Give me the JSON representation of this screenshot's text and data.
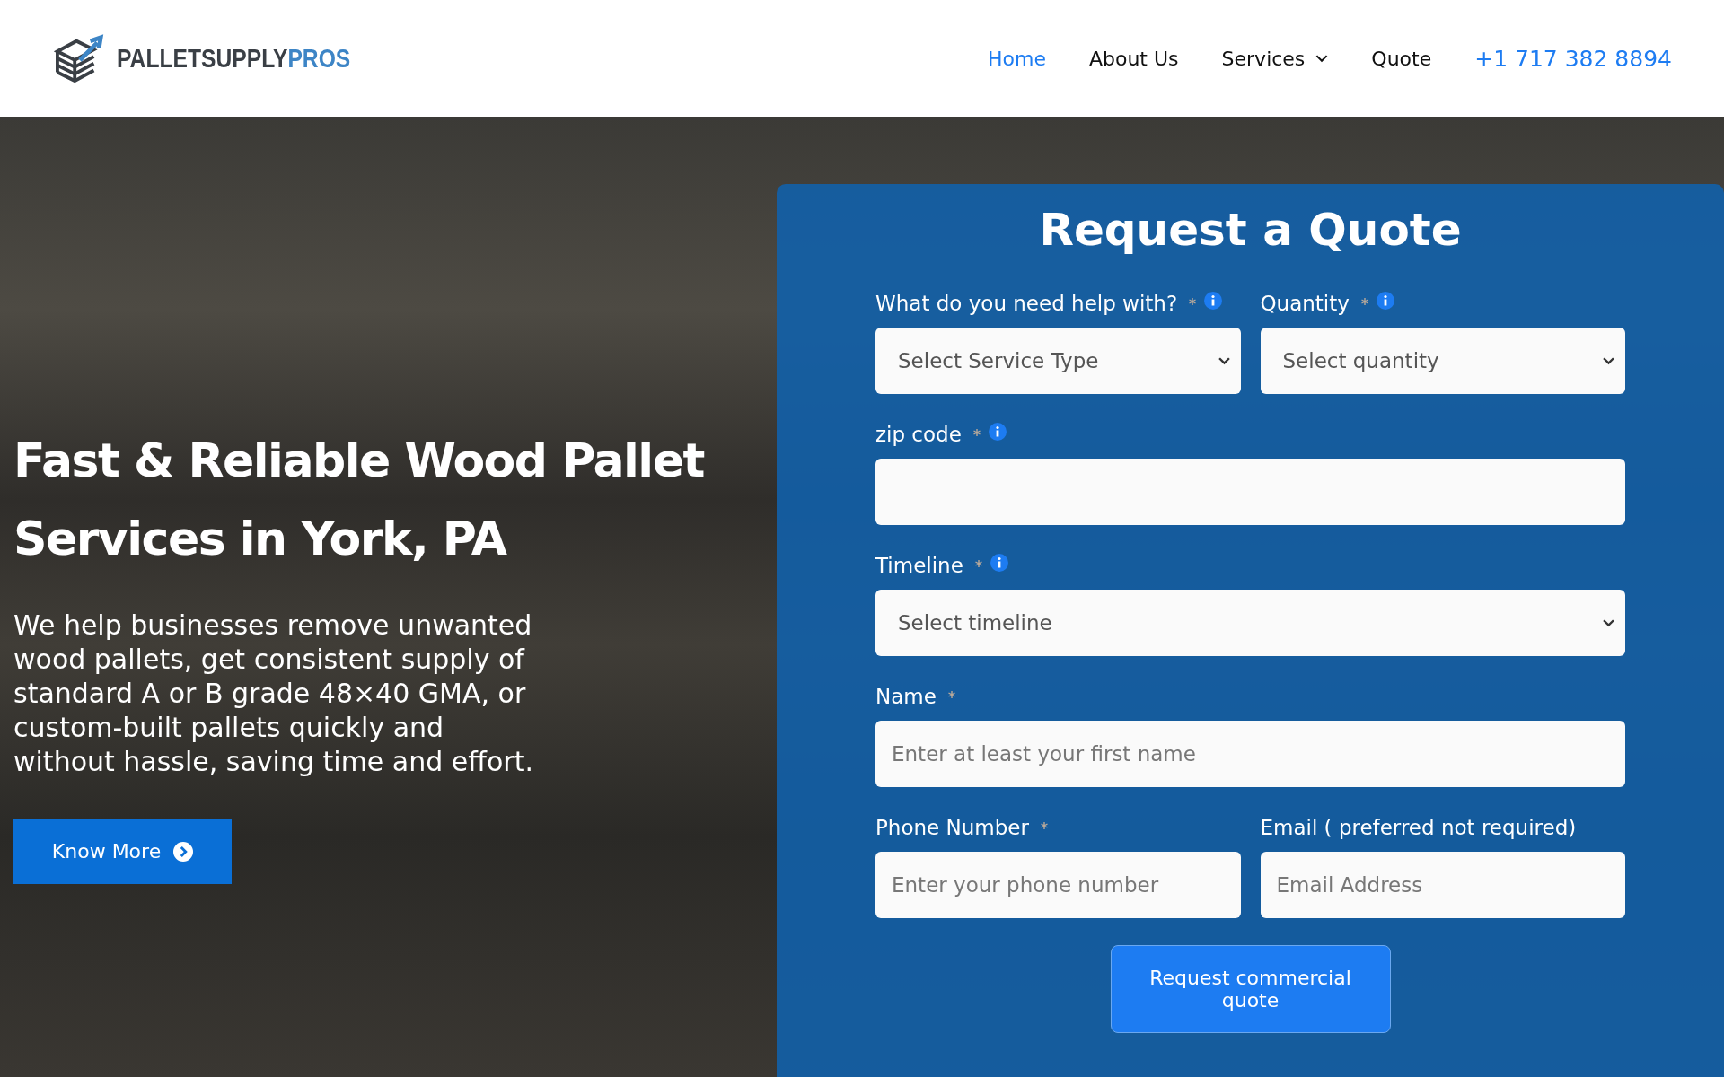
{
  "logo": {
    "name": "PALLETSUPPLY",
    "accent": "PROS"
  },
  "nav": [
    {
      "label": "Home",
      "selected": true,
      "dropdown": false
    },
    {
      "label": "About Us",
      "selected": false,
      "dropdown": false
    },
    {
      "label": "Services",
      "selected": false,
      "dropdown": true
    },
    {
      "label": "Quote",
      "selected": false,
      "dropdown": false
    }
  ],
  "phone": "+1 717 382 8894",
  "hero": {
    "heading": "Fast & Reliable Wood Pallet Services in York, PA",
    "text": "We help businesses remove unwanted wood pallets, get consistent supply of standard A or B grade 48×40 GMA, or custom-built pallets quickly and without hassle, saving time and effort.",
    "button": "Know More"
  },
  "form": {
    "title": "Request a Quote",
    "rows": [
      [
        {
          "label": "What do you need help with?",
          "required": true,
          "info": true,
          "kind": "select",
          "placeholder": "Select Service Type"
        },
        {
          "label": "Quantity",
          "required": true,
          "info": true,
          "kind": "select",
          "placeholder": "Select quantity"
        }
      ],
      [
        {
          "label": "zip code",
          "required": true,
          "info": true,
          "kind": "input"
        }
      ],
      [
        {
          "label": "Timeline",
          "required": true,
          "info": true,
          "kind": "select",
          "placeholder": "Select timeline"
        }
      ],
      [
        {
          "label": "Name",
          "required": true,
          "info": false,
          "kind": "input",
          "placeholder": "Enter at least your first name"
        }
      ],
      [
        {
          "label": "Phone Number",
          "required": true,
          "info": false,
          "kind": "input",
          "placeholder": "Enter your phone number"
        },
        {
          "label": "Email ( preferred not required)",
          "required": false,
          "info": false,
          "kind": "input",
          "placeholder": "Email Address"
        }
      ]
    ],
    "submit": "Request commercial quote"
  }
}
